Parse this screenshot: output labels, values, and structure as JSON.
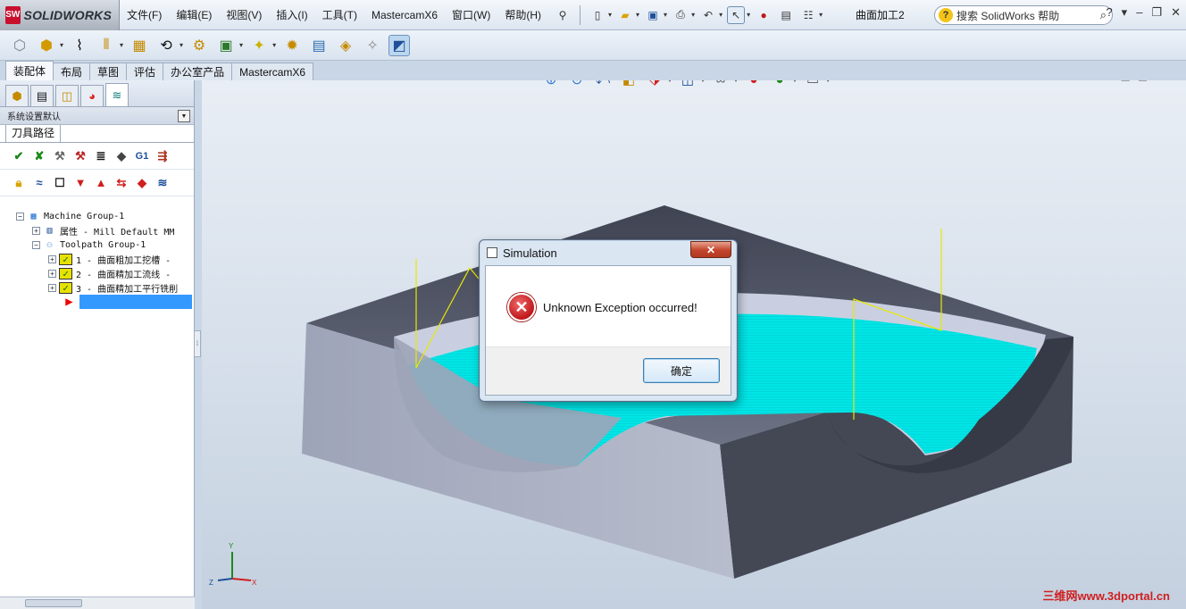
{
  "app": {
    "name": "SOLIDWORKS",
    "logo_mark": "SW"
  },
  "menu": [
    "文件(F)",
    "编辑(E)",
    "视图(V)",
    "插入(I)",
    "工具(T)",
    "MastercamX6",
    "窗口(W)",
    "帮助(H)"
  ],
  "document_title": "曲面加工2",
  "help_search": {
    "placeholder": "搜索 SolidWorks 帮助"
  },
  "tabs": [
    "装配体",
    "布局",
    "草图",
    "评估",
    "办公室产品",
    "MastercamX6"
  ],
  "active_tab": "装配体",
  "panel": {
    "config_label": "系统设置默认",
    "mastercam_tab": "刀具路径",
    "tree": [
      {
        "label": "Machine Group-1"
      },
      {
        "label": "属性 - Mill Default MM"
      },
      {
        "label": "Toolpath Group-1"
      },
      {
        "label": "1 - 曲面粗加工挖槽 -"
      },
      {
        "label": "2 - 曲面精加工流线 -"
      },
      {
        "label": "3 - 曲面精加工平行铣削"
      }
    ]
  },
  "op_toolbar": {
    "g1_label": "G1"
  },
  "triad": {
    "x": "X",
    "y": "Y",
    "z": "Z"
  },
  "dialog": {
    "title": "Simulation",
    "close_glyph": "✕",
    "message": "Unknown Exception occurred!",
    "ok_label": "确定"
  },
  "watermark": "三维网www.3dportal.cn",
  "colors": {
    "toolpath": "#00e5e5",
    "part_top": "#9aa0b3",
    "part_side": "#4b4f5e",
    "error": "#c0171b",
    "selection": "#3399ff"
  }
}
